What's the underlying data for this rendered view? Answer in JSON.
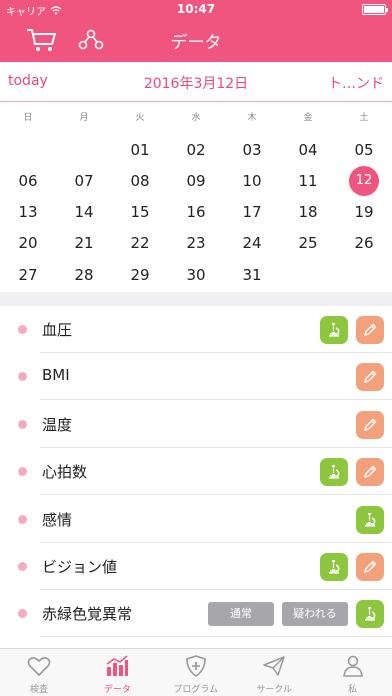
{
  "status_bar": {
    "carrier": "キャリア",
    "time": "10:47"
  },
  "nav": {
    "title": "データ"
  },
  "datebar": {
    "today": "today",
    "date": "2016年3月12日",
    "trend": "ト…ンド"
  },
  "calendar": {
    "weekdays": [
      "日",
      "月",
      "火",
      "水",
      "木",
      "金",
      "土"
    ],
    "weeks": [
      [
        "",
        "",
        "01",
        "02",
        "03",
        "04",
        "05"
      ],
      [
        "06",
        "07",
        "08",
        "09",
        "10",
        "11",
        "12"
      ],
      [
        "13",
        "14",
        "15",
        "16",
        "17",
        "18",
        "19"
      ],
      [
        "20",
        "21",
        "22",
        "23",
        "24",
        "25",
        "26"
      ],
      [
        "27",
        "28",
        "29",
        "30",
        "31",
        "",
        ""
      ]
    ],
    "selected": "12"
  },
  "items": [
    {
      "label": "血圧",
      "buttons": [
        "microscope",
        "pencil"
      ]
    },
    {
      "label": "BMI",
      "buttons": [
        "pencil"
      ]
    },
    {
      "label": "温度",
      "buttons": [
        "pencil"
      ]
    },
    {
      "label": "心拍数",
      "buttons": [
        "microscope",
        "pencil"
      ]
    },
    {
      "label": "感情",
      "buttons": [
        "microscope"
      ]
    },
    {
      "label": "ビジョン値",
      "buttons": [
        "microscope",
        "pencil"
      ]
    },
    {
      "label": "赤緑色覚異常",
      "pills": [
        "通常",
        "疑われる"
      ],
      "buttons": [
        "microscope"
      ]
    }
  ],
  "tabs": [
    {
      "label": "検査",
      "icon": "heart-icon",
      "active": false
    },
    {
      "label": "データ",
      "icon": "chart-icon",
      "active": true
    },
    {
      "label": "プログラム",
      "icon": "shield-plus-icon",
      "active": false
    },
    {
      "label": "サークル",
      "icon": "paper-plane-icon",
      "active": false
    },
    {
      "label": "私",
      "icon": "person-icon",
      "active": false
    }
  ],
  "colors": {
    "accent": "#f0557f",
    "green": "#8dc63f",
    "orange": "#f3a17a",
    "pill": "#a7a7ab"
  }
}
